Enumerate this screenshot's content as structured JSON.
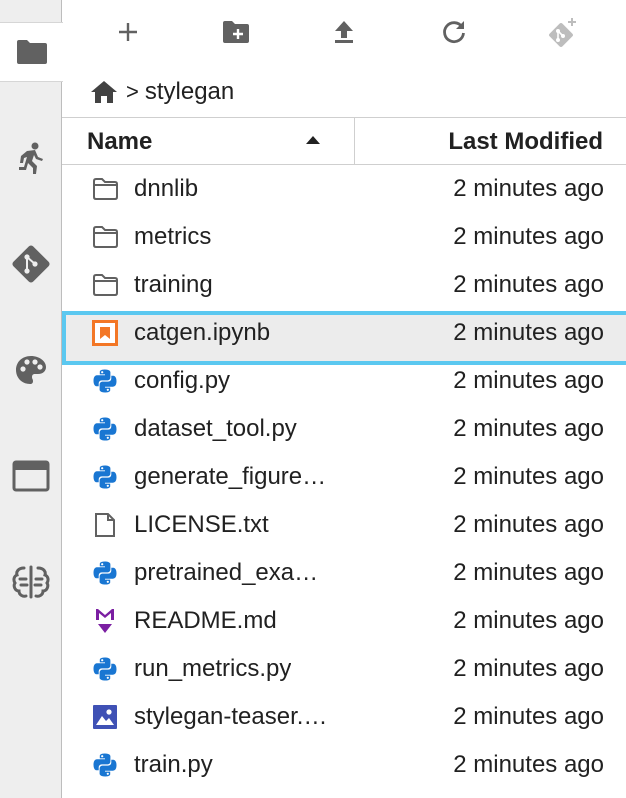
{
  "activity_bar": {
    "items": [
      {
        "name": "folder-icon"
      },
      {
        "name": "running-icon"
      },
      {
        "name": "git-icon"
      },
      {
        "name": "palette-icon"
      },
      {
        "name": "tabs-icon"
      },
      {
        "name": "extension-icon"
      }
    ]
  },
  "toolbar": {
    "buttons": [
      {
        "name": "new-launcher-button",
        "icon": "plus-icon"
      },
      {
        "name": "new-folder-button",
        "icon": "new-folder-icon"
      },
      {
        "name": "upload-button",
        "icon": "upload-icon"
      },
      {
        "name": "refresh-button",
        "icon": "refresh-icon"
      },
      {
        "name": "git-clone-button",
        "icon": "git-clone-icon"
      }
    ]
  },
  "breadcrumb": {
    "separator": ">",
    "current": "stylegan"
  },
  "columns": {
    "name": "Name",
    "modified": "Last Modified"
  },
  "files": [
    {
      "name": "dnnlib",
      "modified": "2 minutes ago",
      "icon": "folder-icon"
    },
    {
      "name": "metrics",
      "modified": "2 minutes ago",
      "icon": "folder-icon"
    },
    {
      "name": "training",
      "modified": "2 minutes ago",
      "icon": "folder-icon"
    },
    {
      "name": "catgen.ipynb",
      "modified": "2 minutes ago",
      "icon": "notebook-icon"
    },
    {
      "name": "config.py",
      "modified": "2 minutes ago",
      "icon": "python-icon"
    },
    {
      "name": "dataset_tool.py",
      "modified": "2 minutes ago",
      "icon": "python-icon"
    },
    {
      "name": "generate_figure…",
      "modified": "2 minutes ago",
      "icon": "python-icon"
    },
    {
      "name": "LICENSE.txt",
      "modified": "2 minutes ago",
      "icon": "text-file-icon"
    },
    {
      "name": "pretrained_exa…",
      "modified": "2 minutes ago",
      "icon": "python-icon"
    },
    {
      "name": "README.md",
      "modified": "2 minutes ago",
      "icon": "markdown-icon"
    },
    {
      "name": "run_metrics.py",
      "modified": "2 minutes ago",
      "icon": "python-icon"
    },
    {
      "name": "stylegan-teaser.…",
      "modified": "2 minutes ago",
      "icon": "image-icon"
    },
    {
      "name": "train.py",
      "modified": "2 minutes ago",
      "icon": "python-icon"
    }
  ],
  "selected_index": 3,
  "colors": {
    "selection_border": "#5bc8f0",
    "notebook_orange": "#f37726",
    "python_blue": "#1976d2",
    "markdown_purple": "#7b1fa2",
    "image_blue": "#3f51b5",
    "icon_gray": "#616161"
  }
}
